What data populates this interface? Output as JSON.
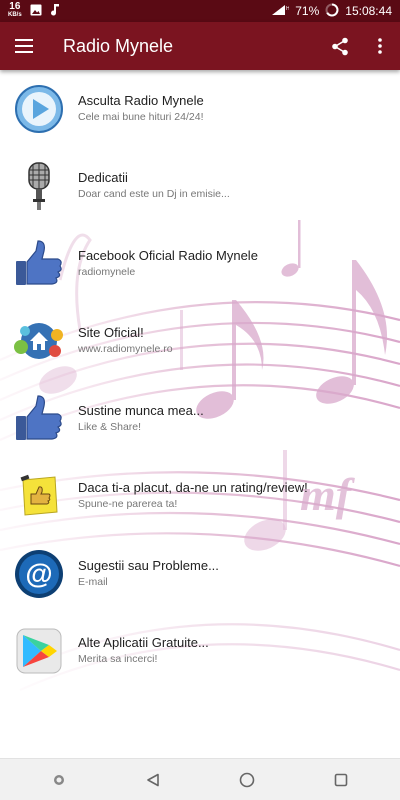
{
  "status_bar": {
    "net_speed": "16",
    "net_unit": "KB/s",
    "battery": "71%",
    "time": "15:08:44"
  },
  "app_bar": {
    "title": "Radio Mynele"
  },
  "menu_items": [
    {
      "title": "Asculta Radio Mynele",
      "subtitle": "Cele mai bune hituri 24/24!",
      "icon": "play-icon"
    },
    {
      "title": "Dedicatii",
      "subtitle": "Doar cand este un Dj in emisie...",
      "icon": "microphone-icon"
    },
    {
      "title": "Facebook Oficial Radio Mynele",
      "subtitle": "radiomynele",
      "icon": "thumbs-up-icon"
    },
    {
      "title": "Site Oficial!",
      "subtitle": "www.radiomynele.ro",
      "icon": "home-icon"
    },
    {
      "title": "Sustine munca mea...",
      "subtitle": "Like & Share!",
      "icon": "thumbs-up-icon"
    },
    {
      "title": "Daca ti-a placut, da-ne un rating/review!",
      "subtitle": "Spune-ne parerea ta!",
      "icon": "rating-note-icon"
    },
    {
      "title": "Sugestii sau Probleme...",
      "subtitle": "E-mail",
      "icon": "email-at-icon"
    },
    {
      "title": "Alte Aplicatii Gratuite...",
      "subtitle": "Merita sa incerci!",
      "icon": "play-store-icon"
    }
  ],
  "background": {
    "watermark_text": "mf"
  },
  "colors": {
    "status_bar": "#5a0a14",
    "app_bar": "#7b1420",
    "accent": "#7b1420"
  }
}
